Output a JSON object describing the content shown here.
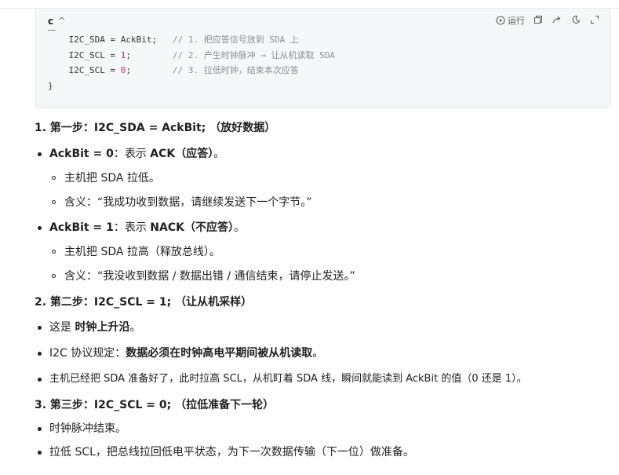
{
  "code_block": {
    "language": "c",
    "run_label": "运行",
    "first_fragment": "{",
    "lines": [
      {
        "code": "    I2C_SDA = AckBit;   ",
        "comment": "// 1. 把应答信号放到 SDA 上"
      },
      {
        "code_pre": "    I2C_SCL = ",
        "num": "1",
        "code_post": ";        ",
        "comment": "// 2. 产生时钟脉冲 → 让从机读取 SDA"
      },
      {
        "code_pre": "    I2C_SCL = ",
        "num": "0",
        "code_post": ";        ",
        "comment": "// 3. 拉低时钟，结束本次应答"
      }
    ],
    "closing": "}"
  },
  "content": {
    "step1": "1. 第一步：I2C_SDA = AckBit; （放好数据）",
    "ack_bold1": "AckBit = 0",
    "ack_mid": "：表示 ",
    "ack_bold2": "ACK（应答）",
    "ack_end": "。",
    "ack_sub1": "主机把 SDA 拉低。",
    "ack_sub2": "含义：“我成功收到数据，请继续发送下一个字节。”",
    "nack_bold1": "AckBit = 1",
    "nack_mid": "：表示 ",
    "nack_bold2": "NACK（不应答）",
    "nack_end": "。",
    "nack_sub1": "主机把 SDA 拉高（释放总线）。",
    "nack_sub2": "含义：“我没收到数据 / 数据出错 / 通信结束，请停止发送。”",
    "step2": "2. 第二步：I2C_SCL = 1; （让从机采样）",
    "s2_b1_pre": "这是 ",
    "s2_b1_bold": "时钟上升沿",
    "s2_b1_end": "。",
    "s2_b2_pre": "I2C 协议规定：",
    "s2_b2_bold": "数据必须在时钟高电平期间被从机读取",
    "s2_b2_end": "。",
    "s2_b3": "主机已经把 SDA 准备好了，此时拉高 SCL，从机盯着 SDA 线，瞬间就能读到 AckBit 的值（0 还是 1）。",
    "step3": "3. 第三步：I2C_SCL = 0; （拉低准备下一轮）",
    "s3_b1": "时钟脉冲结束。",
    "s3_b2": "拉低 SCL，把总线拉回低电平状态，为下一次数据传输（下一位）做准备。"
  }
}
